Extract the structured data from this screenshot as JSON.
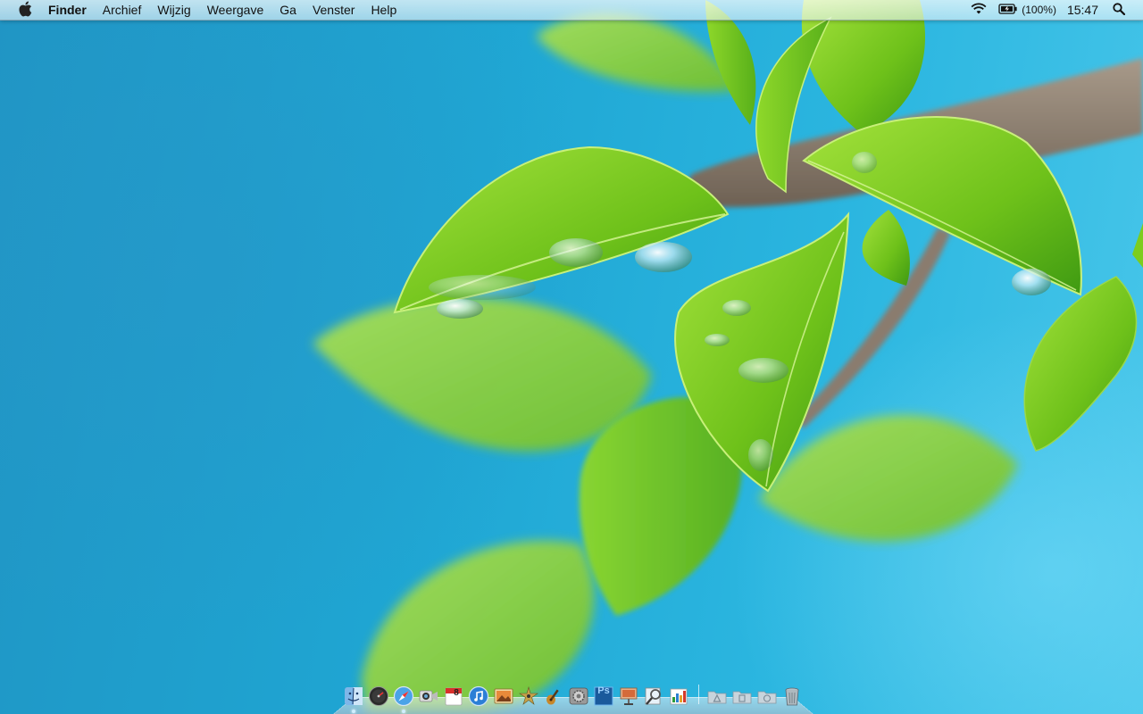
{
  "menubar": {
    "app_name": "Finder",
    "menus": [
      "Archief",
      "Wijzig",
      "Weergave",
      "Ga",
      "Venster",
      "Help"
    ],
    "battery_percent": "(100%)",
    "clock": "15:47",
    "icons": [
      "apple-icon",
      "wifi-icon",
      "battery-icon",
      "spotlight-search-icon"
    ]
  },
  "dock": {
    "apps": [
      {
        "name": "Finder",
        "icon": "finder-icon",
        "running": true
      },
      {
        "name": "Dashboard",
        "icon": "dashboard-icon",
        "running": false
      },
      {
        "name": "Safari",
        "icon": "safari-icon",
        "running": true
      },
      {
        "name": "FaceTime",
        "icon": "facetime-icon",
        "running": false
      },
      {
        "name": "iCal",
        "icon": "calendar-icon",
        "running": false,
        "badge_text": "8"
      },
      {
        "name": "iTunes",
        "icon": "itunes-icon",
        "running": false
      },
      {
        "name": "iPhoto",
        "icon": "photo-icon",
        "running": false
      },
      {
        "name": "Photo Booth",
        "icon": "photo-booth-icon",
        "running": false
      },
      {
        "name": "GarageBand",
        "icon": "garageband-icon",
        "running": false
      },
      {
        "name": "Systeemvoorkeuren",
        "icon": "system-preferences-icon",
        "running": false
      },
      {
        "name": "Photoshop",
        "icon": "photoshop-icon",
        "running": false,
        "badge_text": "Ps"
      },
      {
        "name": "Keynote",
        "icon": "keynote-icon",
        "running": false
      },
      {
        "name": "Preview",
        "icon": "preview-icon",
        "running": false
      },
      {
        "name": "Numbers",
        "icon": "numbers-icon",
        "running": false
      }
    ],
    "stacks": [
      {
        "name": "Programma's",
        "icon": "applications-folder-icon"
      },
      {
        "name": "Documenten",
        "icon": "documents-folder-icon"
      },
      {
        "name": "Downloads",
        "icon": "downloads-folder-icon"
      },
      {
        "name": "Prullenmand",
        "icon": "trash-icon"
      }
    ]
  },
  "colors": {
    "wallpaper_sky": "#1fa6d3",
    "leaf_green": "#7ccd1e",
    "leaf_dark": "#3f9a12",
    "branch": "#8a7c6e"
  }
}
